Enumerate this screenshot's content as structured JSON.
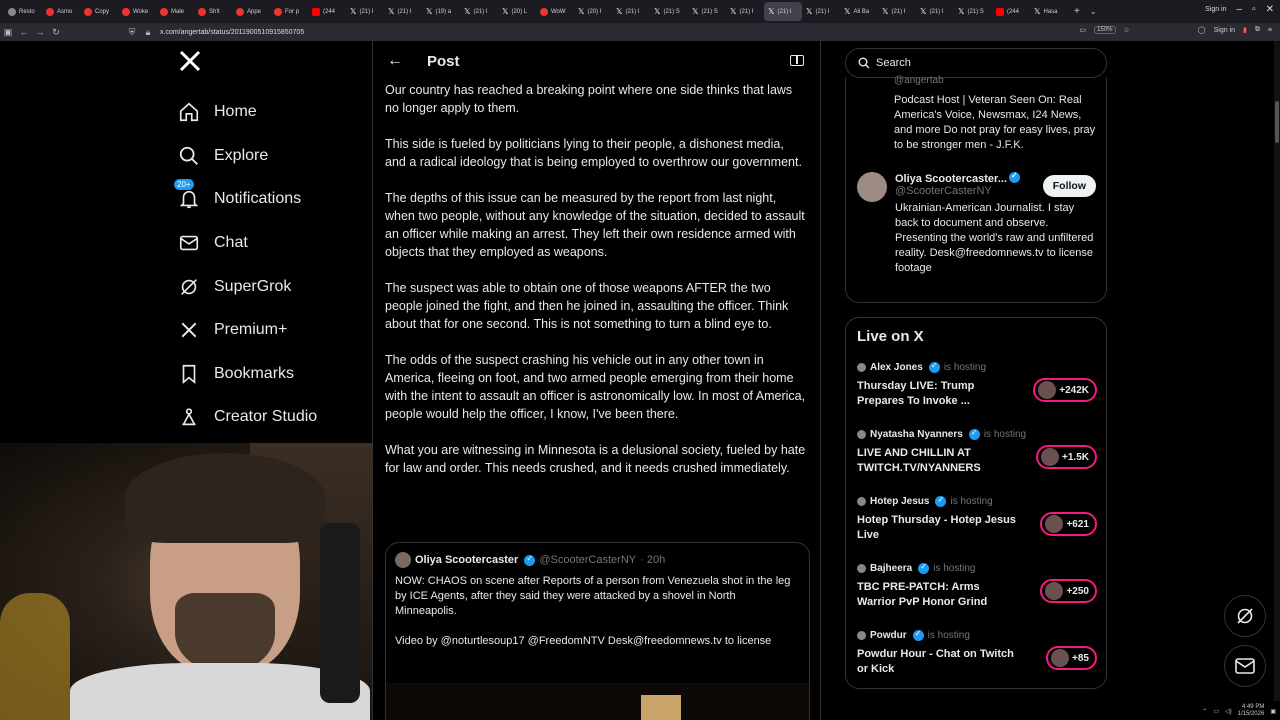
{
  "browser": {
    "tabs": [
      {
        "label": "Resto",
        "icon": "clock-icon"
      },
      {
        "label": "Asmo",
        "icon": "asmongold-icon"
      },
      {
        "label": "Copy",
        "icon": "asmongold-icon"
      },
      {
        "label": "Woke",
        "icon": "asmongold-icon"
      },
      {
        "label": "Male",
        "icon": "asmongold-icon"
      },
      {
        "label": "Sh!t",
        "icon": "asmongold-icon"
      },
      {
        "label": "Appe",
        "icon": "asmongold-icon"
      },
      {
        "label": "For p",
        "icon": "asmongold-icon"
      },
      {
        "label": "(244",
        "icon": "youtube-icon"
      },
      {
        "label": "(21) I",
        "icon": "x-icon"
      },
      {
        "label": "(21) I",
        "icon": "x-icon"
      },
      {
        "label": "(19) a",
        "icon": "x-icon"
      },
      {
        "label": "(21) I",
        "icon": "x-icon"
      },
      {
        "label": "(20) L",
        "icon": "x-icon"
      },
      {
        "label": "WoW",
        "icon": "asmongold-icon"
      },
      {
        "label": "(20) I",
        "icon": "x-icon"
      },
      {
        "label": "(21) I",
        "icon": "x-icon"
      },
      {
        "label": "(21) S",
        "icon": "x-icon"
      },
      {
        "label": "(21) S",
        "icon": "x-icon"
      },
      {
        "label": "(21) I",
        "icon": "x-icon"
      },
      {
        "label": "(21) I",
        "icon": "x-icon"
      },
      {
        "label": "(21) I",
        "icon": "x-icon"
      },
      {
        "label": "Ali Ba",
        "icon": "x-icon"
      },
      {
        "label": "(21) I",
        "icon": "x-icon"
      },
      {
        "label": "(21) I",
        "icon": "x-icon"
      },
      {
        "label": "(21) S",
        "icon": "x-icon"
      },
      {
        "label": "(244",
        "icon": "youtube-icon"
      },
      {
        "label": "Hasa",
        "icon": "x-icon"
      }
    ],
    "active_tab_index": 20,
    "sign_in": "Sign in",
    "url": "x.com/angertab/status/2011900510915850705",
    "zoom": "150%"
  },
  "nav": {
    "items": [
      {
        "label": "Home",
        "icon": "home-icon"
      },
      {
        "label": "Explore",
        "icon": "search-icon"
      },
      {
        "label": "Notifications",
        "icon": "bell-icon",
        "badge": "20+"
      },
      {
        "label": "Chat",
        "icon": "mail-icon"
      },
      {
        "label": "SuperGrok",
        "icon": "grok-icon"
      },
      {
        "label": "Premium+",
        "icon": "x-logo-icon"
      },
      {
        "label": "Bookmarks",
        "icon": "bookmark-icon"
      },
      {
        "label": "Creator Studio",
        "icon": "creator-studio-icon"
      }
    ]
  },
  "post": {
    "header_title": "Post",
    "paragraphs": [
      "Our country has reached a breaking point where one side thinks that laws no longer apply to them.",
      "This side is fueled by politicians lying to their people, a dishonest media, and a radical ideology that is being employed to overthrow our government.",
      "The depths of this issue can be measured by the report from last night, when two people, without any knowledge of the situation, decided to assault an officer while making an arrest. They left their own residence armed with objects that they employed as weapons.",
      "The suspect was able to obtain one of those weapons AFTER the two people joined the fight, and then he joined in, assaulting the officer. Think about that for one second. This is not something to turn a blind eye to.",
      "The odds of the suspect crashing his vehicle out in any other town in America, fleeing on foot, and two armed people emerging from their home with the intent to assault an officer is astronomically low. In most of America, people would help the officer, I know, I've been there.",
      "What you are witnessing in Minnesota is a delusional society, fueled by hate for law and order. This needs crushed, and it needs crushed immediately."
    ],
    "quote": {
      "name": "Oliya Scootercaster",
      "handle": "@ScooterCasterNY",
      "time": "· 20h",
      "text1": "NOW: CHAOS on scene after Reports of a person from Venezuela  shot in the leg by ICE Agents, after they said they were attacked by a shovel in North Minneapolis.",
      "text2": "Video by @noturtlesoup17 @FreedomNTV Desk@freedomnews.tv to license"
    }
  },
  "right": {
    "search_placeholder": "Search",
    "who_to_follow": [
      {
        "handle_partial": "@angertab",
        "bio": "Podcast Host | Veteran Seen On: Real America's Voice, Newsmax, I24 News, and more Do not pray for easy lives, pray to be stronger men - J.F.K."
      },
      {
        "name": "Oliya Scootercaster...",
        "handle": "@ScooterCasterNY",
        "follow_label": "Follow",
        "bio": "Ukrainian-American Journalist. I stay back to document and observe. Presenting the world's raw and unfiltered reality. Desk@freedomnews.tv to license footage"
      }
    ],
    "live": {
      "title": "Live on X",
      "items": [
        {
          "host": "Alex Jones",
          "status": "is hosting",
          "title": "Thursday LIVE: Trump Prepares To Invoke ...",
          "count": "+242K"
        },
        {
          "host": "Nyatasha Nyanners",
          "status": "is hosting",
          "title": "LIVE AND CHILLIN AT TWITCH.TV/NYANNERS",
          "count": "+1.5K"
        },
        {
          "host": "Hotep Jesus",
          "status": "is hosting",
          "title": "Hotep Thursday - Hotep Jesus Live",
          "count": "+621"
        },
        {
          "host": "Bajheera",
          "status": "is hosting",
          "title": "TBC PRE-PATCH: Arms Warrior PvP Honor Grind",
          "count": "+250"
        },
        {
          "host": "Powdur",
          "status": "is hosting",
          "title": "Powdur Hour - Chat on Twitch or Kick",
          "count": "+85"
        }
      ]
    }
  },
  "taskbar": {
    "time": "4:49 PM",
    "date": "1/15/2026"
  },
  "colors": {
    "accent": "#1d9bf0",
    "live_pink": "#f91880",
    "border": "#2f3336",
    "muted": "#71767b"
  }
}
